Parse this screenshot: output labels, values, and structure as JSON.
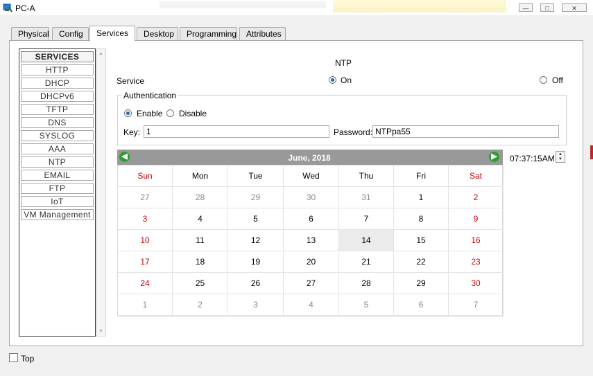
{
  "window": {
    "title": "PC-A",
    "minimize_glyph": "—",
    "maximize_glyph": "□",
    "close_glyph": "✕"
  },
  "tabs": [
    {
      "label": "Physical"
    },
    {
      "label": "Config"
    },
    {
      "label": "Services",
      "active": true
    },
    {
      "label": "Desktop"
    },
    {
      "label": "Programming"
    },
    {
      "label": "Attributes"
    }
  ],
  "services": {
    "header": "SERVICES",
    "items": [
      "HTTP",
      "DHCP",
      "DHCPv6",
      "TFTP",
      "DNS",
      "SYSLOG",
      "AAA",
      "NTP",
      "EMAIL",
      "FTP",
      "IoT",
      "VM Management"
    ]
  },
  "ntp": {
    "title": "NTP",
    "service_label": "Service",
    "on_label": "On",
    "off_label": "Off",
    "service_state": "On",
    "auth_legend": "Authentication",
    "enable_label": "Enable",
    "disable_label": "Disable",
    "auth_state": "Enable",
    "key_label": "Key:",
    "key_value": "1",
    "password_label": "Password:",
    "password_value": "NTPpa55"
  },
  "calendar": {
    "month_year": "June,  2018",
    "prev_glyph": "◀",
    "next_glyph": "▶",
    "weekdays": [
      "Sun",
      "Mon",
      "Tue",
      "Wed",
      "Thu",
      "Fri",
      "Sat"
    ],
    "weeks": [
      [
        "27",
        "28",
        "29",
        "30",
        "31",
        "1",
        "2"
      ],
      [
        "3",
        "4",
        "5",
        "6",
        "7",
        "8",
        "9"
      ],
      [
        "10",
        "11",
        "12",
        "13",
        "14",
        "15",
        "16"
      ],
      [
        "17",
        "18",
        "19",
        "20",
        "21",
        "22",
        "23"
      ],
      [
        "24",
        "25",
        "26",
        "27",
        "28",
        "29",
        "30"
      ],
      [
        "1",
        "2",
        "3",
        "4",
        "5",
        "6",
        "7"
      ]
    ],
    "selected_day": "14",
    "colors": {
      "weekend": "#cc0000",
      "outside_month": "#888888",
      "header_bg": "#999999",
      "nav_green": "#2e9e2e"
    }
  },
  "time": {
    "value": "07:37:15AM",
    "up_glyph": "▲",
    "down_glyph": "▼"
  },
  "footer": {
    "top_label": "Top"
  }
}
